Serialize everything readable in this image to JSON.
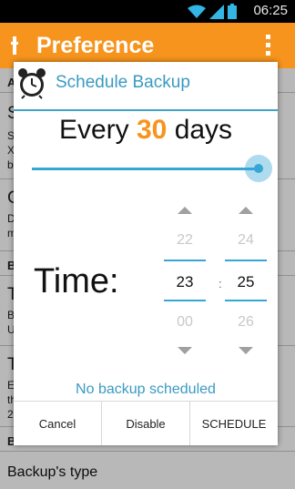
{
  "status_bar": {
    "time": "06:25",
    "icons": [
      "wifi-icon",
      "signal-icon",
      "battery-icon"
    ]
  },
  "action_bar": {
    "title": "Preference",
    "icon": "app-icon",
    "menu_icon": "overflow-menu-icon"
  },
  "background": {
    "items": [
      {
        "text": "A"
      },
      {
        "text": "S"
      },
      {
        "text": "S"
      },
      {
        "text": "X"
      },
      {
        "text": "b"
      },
      {
        "text": "C"
      },
      {
        "text": "D"
      },
      {
        "text": "m"
      },
      {
        "text": "B"
      },
      {
        "text": "T"
      },
      {
        "text": "B"
      },
      {
        "text": "U"
      },
      {
        "text": "T"
      },
      {
        "text": "E"
      },
      {
        "text": "th"
      },
      {
        "text": "2"
      },
      {
        "text": "B"
      },
      {
        "text": "Backup's type"
      }
    ]
  },
  "dialog": {
    "title": "Schedule Backup",
    "icon": "alarm-clock-icon",
    "frequency_prefix": "Every",
    "frequency_value": "30",
    "frequency_suffix": "days",
    "slider_value_fraction": 1.0,
    "time_label": "Time:",
    "hour": {
      "prev": "22",
      "current": "23",
      "next": "00"
    },
    "separator": ":",
    "minute": {
      "prev": "24",
      "current": "25",
      "next": "26"
    },
    "status": "No backup scheduled",
    "buttons": {
      "cancel": "Cancel",
      "disable": "Disable",
      "schedule": "SCHEDULE"
    }
  },
  "colors": {
    "accent_orange": "#f7941d",
    "accent_blue": "#36a6d5"
  }
}
